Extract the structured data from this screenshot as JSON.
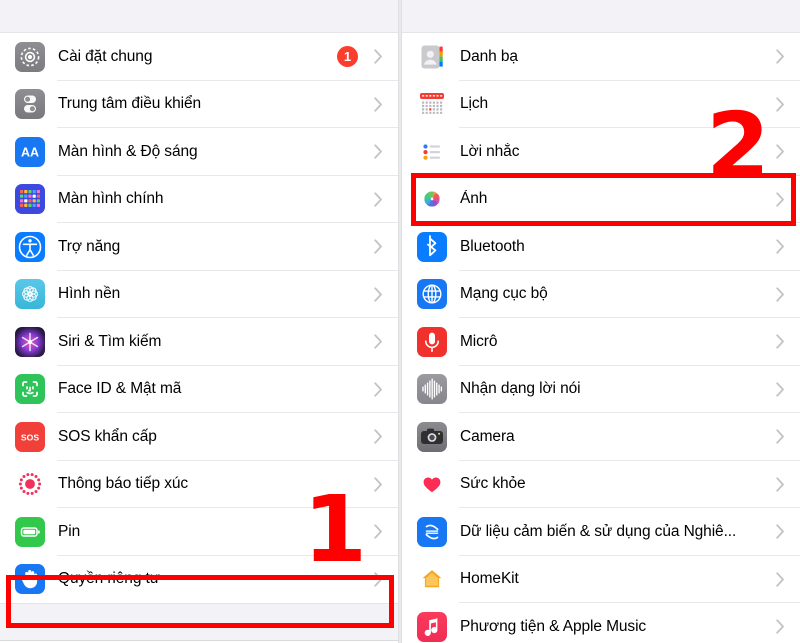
{
  "screen": {
    "title": "iOS Settings — Privacy / Photos",
    "accent_red": "#ff0000",
    "badge_red": "#fc3c2d",
    "statusbar_bg": "#f2f2f7",
    "row_bg": "#ffffff",
    "separator": "#e8e8ec"
  },
  "left_panel": {
    "name": "settings-list-left",
    "rows": [
      {
        "label": "Cài đặt chung",
        "icon": "gear-icon",
        "badge": "1"
      },
      {
        "label": "Trung tâm điều khiển",
        "icon": "control-center-icon",
        "badge": ""
      },
      {
        "label": "Màn hình & Độ sáng",
        "icon": "display-brightness-icon",
        "badge": ""
      },
      {
        "label": "Màn hình chính",
        "icon": "home-screen-icon",
        "badge": ""
      },
      {
        "label": "Trợ năng",
        "icon": "accessibility-icon",
        "badge": ""
      },
      {
        "label": "Hình nền",
        "icon": "wallpaper-icon",
        "badge": ""
      },
      {
        "label": "Siri & Tìm kiếm",
        "icon": "siri-icon",
        "badge": ""
      },
      {
        "label": "Face ID & Mật mã",
        "icon": "face-id-icon",
        "badge": ""
      },
      {
        "label": "SOS khẩn cấp",
        "icon": "sos-icon",
        "badge": ""
      },
      {
        "label": "Thông báo tiếp xúc",
        "icon": "exposure-notification-icon",
        "badge": ""
      },
      {
        "label": "Pin",
        "icon": "battery-icon",
        "badge": ""
      },
      {
        "label": "Quyền riêng tư",
        "icon": "privacy-hand-icon",
        "badge": ""
      }
    ]
  },
  "right_panel": {
    "name": "privacy-list-right",
    "rows": [
      {
        "label": "Danh bạ",
        "icon": "contacts-icon"
      },
      {
        "label": "Lịch",
        "icon": "calendar-icon"
      },
      {
        "label": "Lời nhắc",
        "icon": "reminders-icon"
      },
      {
        "label": "Ảnh",
        "icon": "photos-icon"
      },
      {
        "label": "Bluetooth",
        "icon": "bluetooth-icon"
      },
      {
        "label": "Mạng cục bộ",
        "icon": "local-network-icon"
      },
      {
        "label": "Micrô",
        "icon": "microphone-icon"
      },
      {
        "label": "Nhận dạng lời nói",
        "icon": "speech-recognition-icon"
      },
      {
        "label": "Camera",
        "icon": "camera-icon"
      },
      {
        "label": "Sức khỏe",
        "icon": "health-icon"
      },
      {
        "label": "Dữ liệu cảm biến & sử dụng của Nghiê...",
        "icon": "research-sensor-icon"
      },
      {
        "label": "HomeKit",
        "icon": "homekit-icon"
      },
      {
        "label": "Phương tiện & Apple Music",
        "icon": "music-icon"
      }
    ]
  },
  "annotations": {
    "step_one": "1",
    "step_two": "2",
    "highlight_left_label": "Quyền riêng tư",
    "highlight_right_label": "Ảnh"
  }
}
